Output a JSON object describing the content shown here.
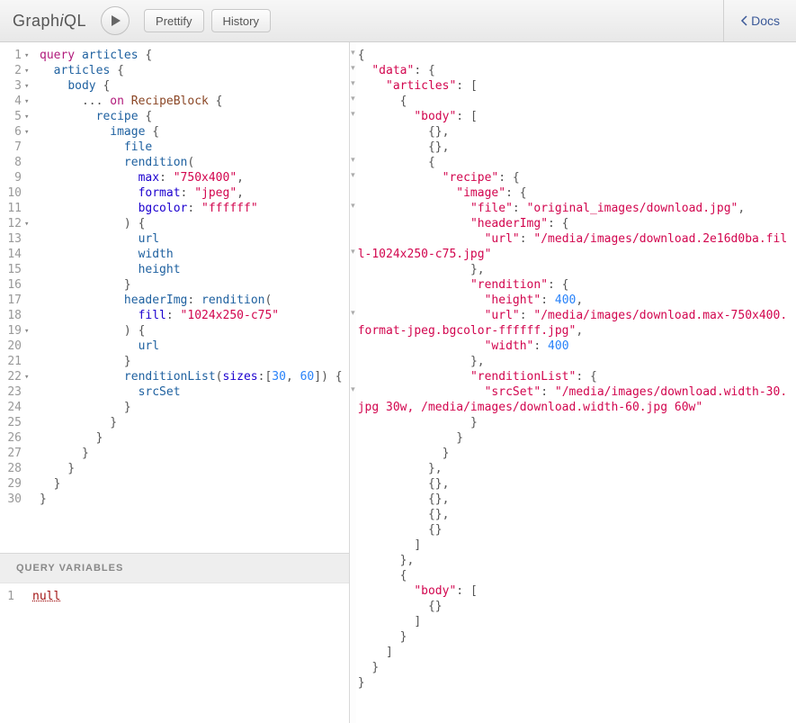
{
  "logo_parts": {
    "pre": "Graph",
    "i": "i",
    "post": "QL"
  },
  "buttons": {
    "prettify": "Prettify",
    "history": "History",
    "docs": "Docs"
  },
  "vars_header": "QUERY VARIABLES",
  "vars_value": "null",
  "query_lines": [
    {
      "n": 1,
      "fold": true,
      "tokens": [
        [
          "kw",
          "query"
        ],
        [
          "punc",
          " "
        ],
        [
          "def",
          "articles"
        ],
        [
          "punc",
          " {"
        ]
      ]
    },
    {
      "n": 2,
      "fold": true,
      "tokens": [
        [
          "punc",
          "  "
        ],
        [
          "attr",
          "articles"
        ],
        [
          "punc",
          " {"
        ]
      ]
    },
    {
      "n": 3,
      "fold": true,
      "tokens": [
        [
          "punc",
          "    "
        ],
        [
          "attr",
          "body"
        ],
        [
          "punc",
          " {"
        ]
      ]
    },
    {
      "n": 4,
      "fold": true,
      "tokens": [
        [
          "punc",
          "      ... "
        ],
        [
          "kw",
          "on"
        ],
        [
          "punc",
          " "
        ],
        [
          "prop",
          "RecipeBlock"
        ],
        [
          "punc",
          " {"
        ]
      ]
    },
    {
      "n": 5,
      "fold": true,
      "tokens": [
        [
          "punc",
          "        "
        ],
        [
          "attr",
          "recipe"
        ],
        [
          "punc",
          " {"
        ]
      ]
    },
    {
      "n": 6,
      "fold": true,
      "tokens": [
        [
          "punc",
          "          "
        ],
        [
          "attr",
          "image"
        ],
        [
          "punc",
          " {"
        ]
      ]
    },
    {
      "n": 7,
      "fold": false,
      "tokens": [
        [
          "punc",
          "            "
        ],
        [
          "attr",
          "file"
        ]
      ]
    },
    {
      "n": 8,
      "fold": false,
      "tokens": [
        [
          "punc",
          "            "
        ],
        [
          "attr",
          "rendition"
        ],
        [
          "punc",
          "("
        ]
      ]
    },
    {
      "n": 9,
      "fold": false,
      "tokens": [
        [
          "punc",
          "              "
        ],
        [
          "qual",
          "max"
        ],
        [
          "punc",
          ": "
        ],
        [
          "str",
          "\"750x400\""
        ],
        [
          "punc",
          ","
        ]
      ]
    },
    {
      "n": 10,
      "fold": false,
      "tokens": [
        [
          "punc",
          "              "
        ],
        [
          "qual",
          "format"
        ],
        [
          "punc",
          ": "
        ],
        [
          "str",
          "\"jpeg\""
        ],
        [
          "punc",
          ","
        ]
      ]
    },
    {
      "n": 11,
      "fold": false,
      "tokens": [
        [
          "punc",
          "              "
        ],
        [
          "qual",
          "bgcolor"
        ],
        [
          "punc",
          ": "
        ],
        [
          "str",
          "\"ffffff\""
        ]
      ]
    },
    {
      "n": 12,
      "fold": true,
      "tokens": [
        [
          "punc",
          "            ) {"
        ]
      ]
    },
    {
      "n": 13,
      "fold": false,
      "tokens": [
        [
          "punc",
          "              "
        ],
        [
          "attr",
          "url"
        ]
      ]
    },
    {
      "n": 14,
      "fold": false,
      "tokens": [
        [
          "punc",
          "              "
        ],
        [
          "attr",
          "width"
        ]
      ]
    },
    {
      "n": 15,
      "fold": false,
      "tokens": [
        [
          "punc",
          "              "
        ],
        [
          "attr",
          "height"
        ]
      ]
    },
    {
      "n": 16,
      "fold": false,
      "tokens": [
        [
          "punc",
          "            }"
        ]
      ]
    },
    {
      "n": 17,
      "fold": false,
      "tokens": [
        [
          "punc",
          "            "
        ],
        [
          "def",
          "headerImg"
        ],
        [
          "punc",
          ": "
        ],
        [
          "attr",
          "rendition"
        ],
        [
          "punc",
          "("
        ]
      ]
    },
    {
      "n": 18,
      "fold": false,
      "tokens": [
        [
          "punc",
          "              "
        ],
        [
          "qual",
          "fill"
        ],
        [
          "punc",
          ": "
        ],
        [
          "str",
          "\"1024x250-c75\""
        ]
      ]
    },
    {
      "n": 19,
      "fold": true,
      "tokens": [
        [
          "punc",
          "            ) {"
        ]
      ]
    },
    {
      "n": 20,
      "fold": false,
      "tokens": [
        [
          "punc",
          "              "
        ],
        [
          "attr",
          "url"
        ]
      ]
    },
    {
      "n": 21,
      "fold": false,
      "tokens": [
        [
          "punc",
          "            }"
        ]
      ]
    },
    {
      "n": 22,
      "fold": true,
      "tokens": [
        [
          "punc",
          "            "
        ],
        [
          "attr",
          "renditionList"
        ],
        [
          "punc",
          "("
        ],
        [
          "qual",
          "sizes"
        ],
        [
          "punc",
          ":["
        ],
        [
          "num",
          "30"
        ],
        [
          "punc",
          ", "
        ],
        [
          "num",
          "60"
        ],
        [
          "punc",
          "]) {"
        ]
      ]
    },
    {
      "n": 23,
      "fold": false,
      "tokens": [
        [
          "punc",
          "              "
        ],
        [
          "attr",
          "srcSet"
        ]
      ]
    },
    {
      "n": 24,
      "fold": false,
      "tokens": [
        [
          "punc",
          "            }"
        ]
      ]
    },
    {
      "n": 25,
      "fold": false,
      "tokens": [
        [
          "punc",
          "          }"
        ]
      ]
    },
    {
      "n": 26,
      "fold": false,
      "tokens": [
        [
          "punc",
          "        }"
        ]
      ]
    },
    {
      "n": 27,
      "fold": false,
      "tokens": [
        [
          "punc",
          "      }"
        ]
      ]
    },
    {
      "n": 28,
      "fold": false,
      "tokens": [
        [
          "punc",
          "    }"
        ]
      ]
    },
    {
      "n": 29,
      "fold": false,
      "tokens": [
        [
          "punc",
          "  }"
        ]
      ]
    },
    {
      "n": 30,
      "fold": false,
      "tokens": [
        [
          "punc",
          "}"
        ]
      ]
    }
  ],
  "result_fold_rows": [
    0,
    1,
    2,
    3,
    4,
    7,
    8,
    10,
    13,
    17,
    22
  ],
  "result_lines": [
    [
      [
        "punc",
        "{"
      ]
    ],
    [
      [
        "punc",
        "  "
      ],
      [
        "str",
        "\"data\""
      ],
      [
        "punc",
        ": {"
      ]
    ],
    [
      [
        "punc",
        "    "
      ],
      [
        "str",
        "\"articles\""
      ],
      [
        "punc",
        ": ["
      ]
    ],
    [
      [
        "punc",
        "      {"
      ]
    ],
    [
      [
        "punc",
        "        "
      ],
      [
        "str",
        "\"body\""
      ],
      [
        "punc",
        ": ["
      ]
    ],
    [
      [
        "punc",
        "          {},"
      ]
    ],
    [
      [
        "punc",
        "          {},"
      ]
    ],
    [
      [
        "punc",
        "          {"
      ]
    ],
    [
      [
        "punc",
        "            "
      ],
      [
        "str",
        "\"recipe\""
      ],
      [
        "punc",
        ": {"
      ]
    ],
    [
      [
        "punc",
        "              "
      ],
      [
        "str",
        "\"image\""
      ],
      [
        "punc",
        ": {"
      ]
    ],
    [
      [
        "punc",
        "                "
      ],
      [
        "str",
        "\"file\""
      ],
      [
        "punc",
        ": "
      ],
      [
        "str",
        "\"original_images/download.jpg\""
      ],
      [
        "punc",
        ","
      ]
    ],
    [
      [
        "punc",
        "                "
      ],
      [
        "str",
        "\"headerImg\""
      ],
      [
        "punc",
        ": {"
      ]
    ],
    [
      [
        "punc",
        "                  "
      ],
      [
        "str",
        "\"url\""
      ],
      [
        "punc",
        ": "
      ],
      [
        "str",
        "\"/media/images/download.2e16d0ba.fill-1024x250-c75.jpg\""
      ]
    ],
    [
      [
        "punc",
        "                },"
      ]
    ],
    [
      [
        "punc",
        "                "
      ],
      [
        "str",
        "\"rendition\""
      ],
      [
        "punc",
        ": {"
      ]
    ],
    [
      [
        "punc",
        "                  "
      ],
      [
        "str",
        "\"height\""
      ],
      [
        "punc",
        ": "
      ],
      [
        "num",
        "400"
      ],
      [
        "punc",
        ","
      ]
    ],
    [
      [
        "punc",
        "                  "
      ],
      [
        "str",
        "\"url\""
      ],
      [
        "punc",
        ": "
      ],
      [
        "str",
        "\"/media/images/download.max-750x400.format-jpeg.bgcolor-ffffff.jpg\""
      ],
      [
        "punc",
        ","
      ]
    ],
    [
      [
        "punc",
        "                  "
      ],
      [
        "str",
        "\"width\""
      ],
      [
        "punc",
        ": "
      ],
      [
        "num",
        "400"
      ]
    ],
    [
      [
        "punc",
        "                },"
      ]
    ],
    [
      [
        "punc",
        "                "
      ],
      [
        "str",
        "\"renditionList\""
      ],
      [
        "punc",
        ": {"
      ]
    ],
    [
      [
        "punc",
        "                  "
      ],
      [
        "str",
        "\"srcSet\""
      ],
      [
        "punc",
        ": "
      ],
      [
        "str",
        "\"/media/images/download.width-30.jpg 30w, /media/images/download.width-60.jpg 60w\""
      ]
    ],
    [
      [
        "punc",
        "                }"
      ]
    ],
    [
      [
        "punc",
        "              }"
      ]
    ],
    [
      [
        "punc",
        "            }"
      ]
    ],
    [
      [
        "punc",
        "          },"
      ]
    ],
    [
      [
        "punc",
        "          {},"
      ]
    ],
    [
      [
        "punc",
        "          {},"
      ]
    ],
    [
      [
        "punc",
        "          {},"
      ]
    ],
    [
      [
        "punc",
        "          {}"
      ]
    ],
    [
      [
        "punc",
        "        ]"
      ]
    ],
    [
      [
        "punc",
        "      },"
      ]
    ],
    [
      [
        "punc",
        "      {"
      ]
    ],
    [
      [
        "punc",
        "        "
      ],
      [
        "str",
        "\"body\""
      ],
      [
        "punc",
        ": ["
      ]
    ],
    [
      [
        "punc",
        "          {}"
      ]
    ],
    [
      [
        "punc",
        "        ]"
      ]
    ],
    [
      [
        "punc",
        "      }"
      ]
    ],
    [
      [
        "punc",
        "    ]"
      ]
    ],
    [
      [
        "punc",
        "  }"
      ]
    ],
    [
      [
        "punc",
        "}"
      ]
    ]
  ]
}
